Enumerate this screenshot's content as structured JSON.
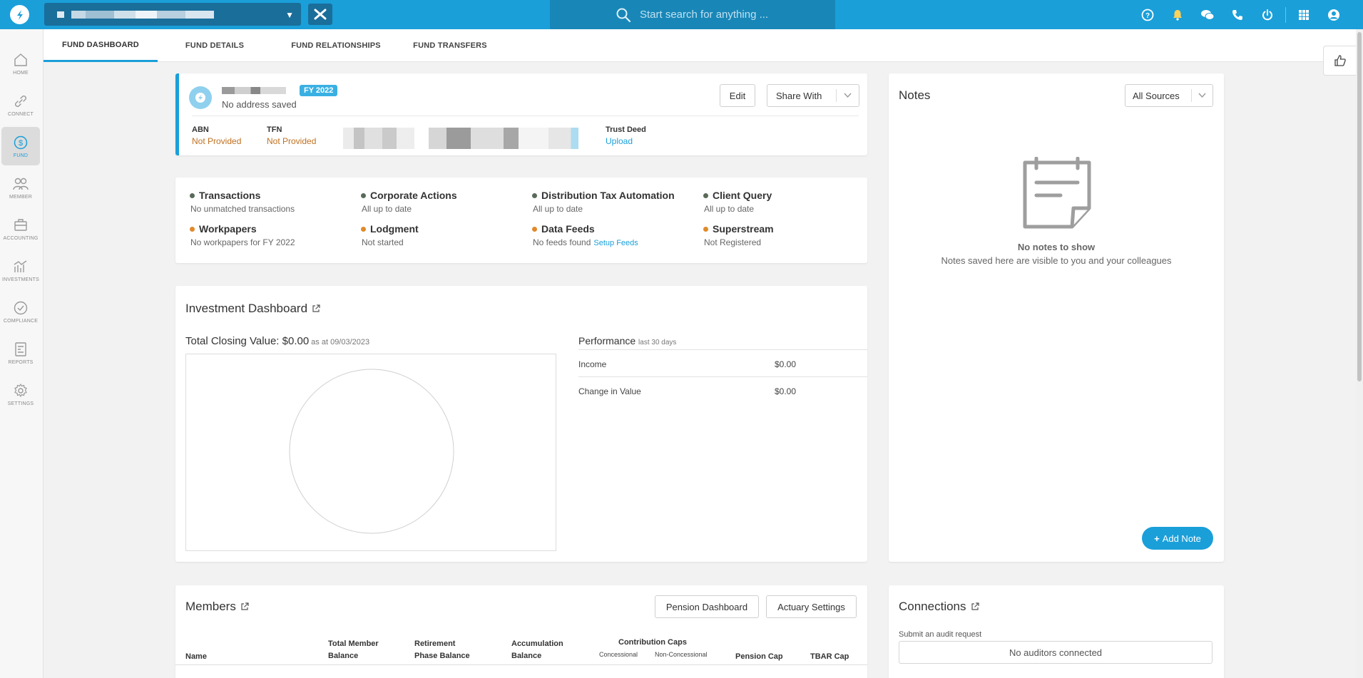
{
  "search": {
    "placeholder": "Start search for anything ..."
  },
  "sidebar": {
    "items": [
      {
        "label": "HOME",
        "icon": "home-icon"
      },
      {
        "label": "CONNECT",
        "icon": "link-icon"
      },
      {
        "label": "FUND",
        "icon": "dollar-icon",
        "active": true
      },
      {
        "label": "MEMBER",
        "icon": "users-icon"
      },
      {
        "label": "ACCOUNTING",
        "icon": "briefcase-icon"
      },
      {
        "label": "INVESTMENTS",
        "icon": "chart-icon"
      },
      {
        "label": "COMPLIANCE",
        "icon": "check-circle-icon"
      },
      {
        "label": "REPORTS",
        "icon": "report-icon"
      },
      {
        "label": "SETTINGS",
        "icon": "gear-icon"
      }
    ]
  },
  "tabs": [
    {
      "label": "FUND DASHBOARD",
      "active": true
    },
    {
      "label": "FUND DETAILS"
    },
    {
      "label": "FUND RELATIONSHIPS"
    },
    {
      "label": "FUND TRANSFERS"
    }
  ],
  "fund": {
    "fy_badge": "FY 2022",
    "address": "No address saved",
    "edit_label": "Edit",
    "share_label": "Share With",
    "fields": [
      {
        "label": "ABN",
        "value": "Not Provided"
      },
      {
        "label": "TFN",
        "value": "Not Provided"
      },
      {
        "label": "Trust Deed",
        "value": "Upload"
      }
    ]
  },
  "statuses": [
    {
      "title": "Transactions",
      "sub": "No unmatched transactions",
      "color": "#5a6a5a"
    },
    {
      "title": "Corporate Actions",
      "sub": "All up to date",
      "color": "#5a6a5a"
    },
    {
      "title": "Distribution Tax Automation",
      "sub": "All up to date",
      "color": "#5a6a5a"
    },
    {
      "title": "Client Query",
      "sub": "All up to date",
      "color": "#5a6a5a"
    },
    {
      "title": "Workpapers",
      "sub": "No workpapers for FY 2022",
      "color": "#e08a2a"
    },
    {
      "title": "Lodgment",
      "sub": "Not started",
      "color": "#e08a2a"
    },
    {
      "title": "Data Feeds",
      "sub": "No feeds found",
      "link": "Setup Feeds",
      "color": "#e08a2a"
    },
    {
      "title": "Superstream",
      "sub": "Not Registered",
      "color": "#e08a2a"
    }
  ],
  "investment": {
    "title": "Investment Dashboard",
    "total_label": "Total Closing Value: $0.00",
    "as_at": "as at 09/03/2023",
    "performance_title": "Performance",
    "performance_period": "last 30 days",
    "rows": [
      {
        "label": "Income",
        "value": "$0.00"
      },
      {
        "label": "Change in Value",
        "value": "$0.00"
      }
    ]
  },
  "members": {
    "title": "Members",
    "pension_btn": "Pension Dashboard",
    "actuary_btn": "Actuary Settings",
    "headers": {
      "name": "Name",
      "total_balance": [
        "Total Member",
        "Balance"
      ],
      "retirement": [
        "Retirement",
        "Phase Balance"
      ],
      "accumulation": [
        "Accumulation",
        "Balance"
      ],
      "contribution_caps": "Contribution Caps",
      "concessional": "Concessional",
      "non_concessional": "Non-Concessional",
      "pension_cap": "Pension Cap",
      "tbar_cap": "TBAR Cap"
    }
  },
  "notes": {
    "title": "Notes",
    "source_select": "All Sources",
    "empty_title": "No notes to show",
    "empty_desc": "Notes saved here are visible to you and your colleagues",
    "add_label": "Add Note"
  },
  "connections": {
    "title": "Connections",
    "sub": "Submit an audit request",
    "empty": "No auditors connected"
  },
  "colors": {
    "brand": "#1a9fd9",
    "warning": "#c07020"
  }
}
